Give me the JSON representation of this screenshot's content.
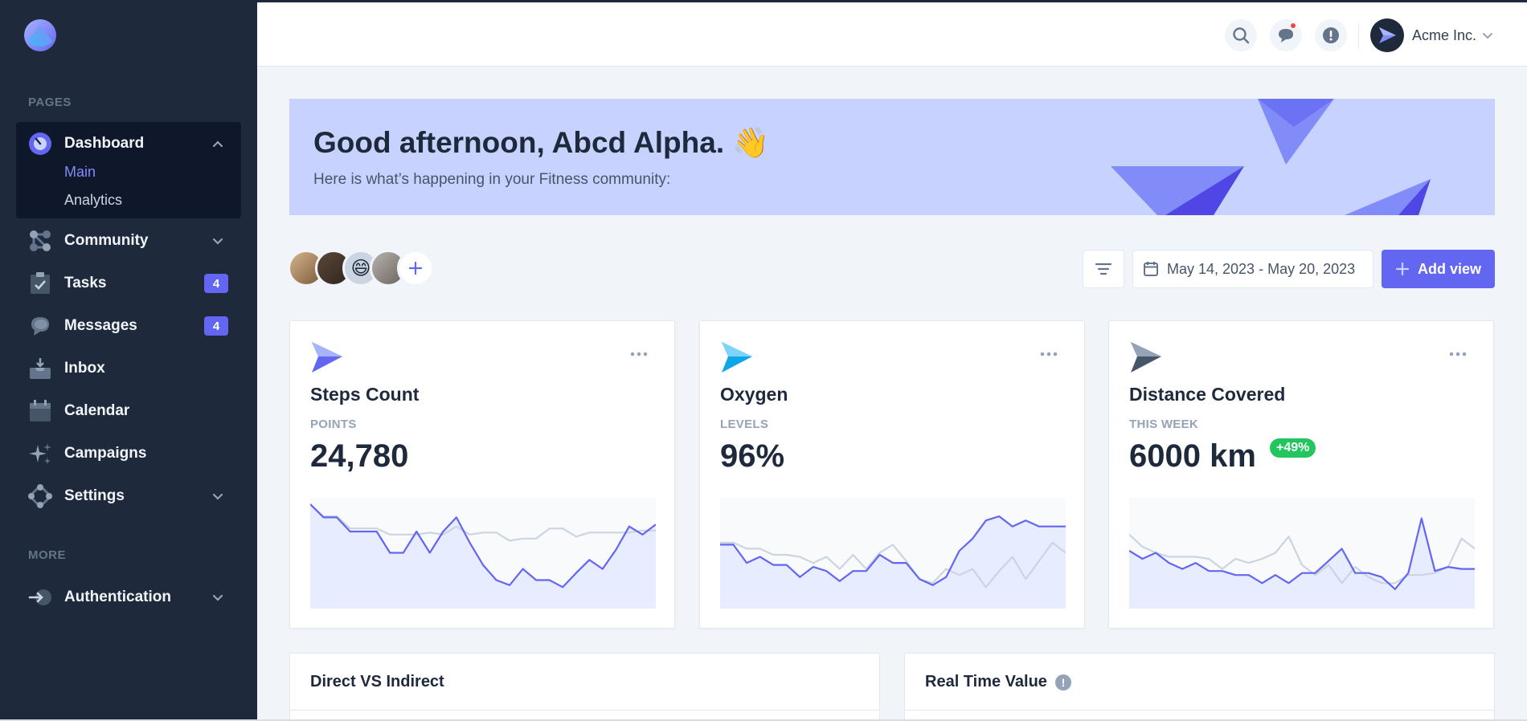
{
  "sidebar": {
    "section_pages": "PAGES",
    "section_more": "MORE",
    "dashboard": {
      "label": "Dashboard",
      "sub": [
        "Main",
        "Analytics"
      ]
    },
    "items": [
      {
        "label": "Community",
        "icon": "community-icon",
        "chevron": true
      },
      {
        "label": "Tasks",
        "icon": "tasks-icon",
        "badge": "4"
      },
      {
        "label": "Messages",
        "icon": "messages-icon",
        "badge": "4"
      },
      {
        "label": "Inbox",
        "icon": "inbox-icon"
      },
      {
        "label": "Calendar",
        "icon": "calendar-icon"
      },
      {
        "label": "Campaigns",
        "icon": "campaigns-icon"
      },
      {
        "label": "Settings",
        "icon": "settings-icon",
        "chevron": true
      }
    ],
    "auth": {
      "label": "Authentication",
      "icon": "authentication-icon"
    }
  },
  "header": {
    "account_name": "Acme Inc."
  },
  "banner": {
    "greeting": "Good afternoon, Abcd Alpha. 👋",
    "subtitle": "Here is what’s happening in your Fitness community:"
  },
  "toolbar": {
    "date_range": "May 14, 2023 - May 20, 2023",
    "add_view": "Add view"
  },
  "cards": [
    {
      "title": "Steps Count",
      "caption": "POINTS",
      "value": "24,780"
    },
    {
      "title": "Oxygen",
      "caption": "LEVELS",
      "value": "96%"
    },
    {
      "title": "Distance Covered",
      "caption": "THIS WEEK",
      "value": "6000 km",
      "delta": "+49%"
    }
  ],
  "panels": [
    {
      "title": "Direct VS Indirect"
    },
    {
      "title": "Real Time Value",
      "info": "!"
    }
  ],
  "colors": {
    "accent": "#6366f1",
    "sidebar": "#1e293b",
    "banner": "#c7d2fe",
    "success": "#22c55e"
  },
  "chart_data": [
    {
      "type": "line",
      "series": [
        {
          "values": [
            100,
            87,
            87,
            73,
            73,
            73,
            52,
            52,
            73,
            52,
            73,
            87,
            62,
            40,
            25,
            20,
            36,
            25,
            25,
            18,
            32,
            45,
            36,
            55,
            78,
            70,
            80
          ]
        },
        {
          "values": [
            100,
            88,
            88,
            76,
            76,
            76,
            70,
            70,
            70,
            72,
            70,
            78,
            70,
            72,
            72,
            64,
            66,
            66,
            76,
            76,
            68,
            72,
            72,
            72,
            72,
            74,
            74
          ]
        }
      ]
    },
    {
      "type": "line",
      "series": [
        {
          "values": [
            60,
            60,
            42,
            48,
            40,
            40,
            28,
            38,
            34,
            24,
            34,
            34,
            50,
            42,
            42,
            26,
            20,
            28,
            54,
            66,
            84,
            88,
            78,
            84,
            78,
            78,
            78
          ]
        },
        {
          "values": [
            62,
            62,
            56,
            56,
            50,
            50,
            48,
            42,
            48,
            36,
            50,
            36,
            52,
            60,
            44,
            26,
            22,
            36,
            30,
            36,
            18,
            34,
            48,
            26,
            44,
            62,
            52
          ]
        }
      ]
    },
    {
      "type": "line",
      "series": [
        {
          "values": [
            54,
            46,
            52,
            42,
            36,
            42,
            34,
            34,
            30,
            30,
            22,
            30,
            22,
            32,
            32,
            44,
            56,
            32,
            32,
            28,
            16,
            32,
            86,
            34,
            38,
            36,
            36
          ]
        },
        {
          "values": [
            70,
            58,
            52,
            48,
            48,
            48,
            46,
            36,
            46,
            42,
            46,
            52,
            68,
            40,
            30,
            40,
            22,
            38,
            28,
            22,
            22,
            30,
            30,
            32,
            38,
            66,
            56
          ]
        }
      ]
    }
  ]
}
